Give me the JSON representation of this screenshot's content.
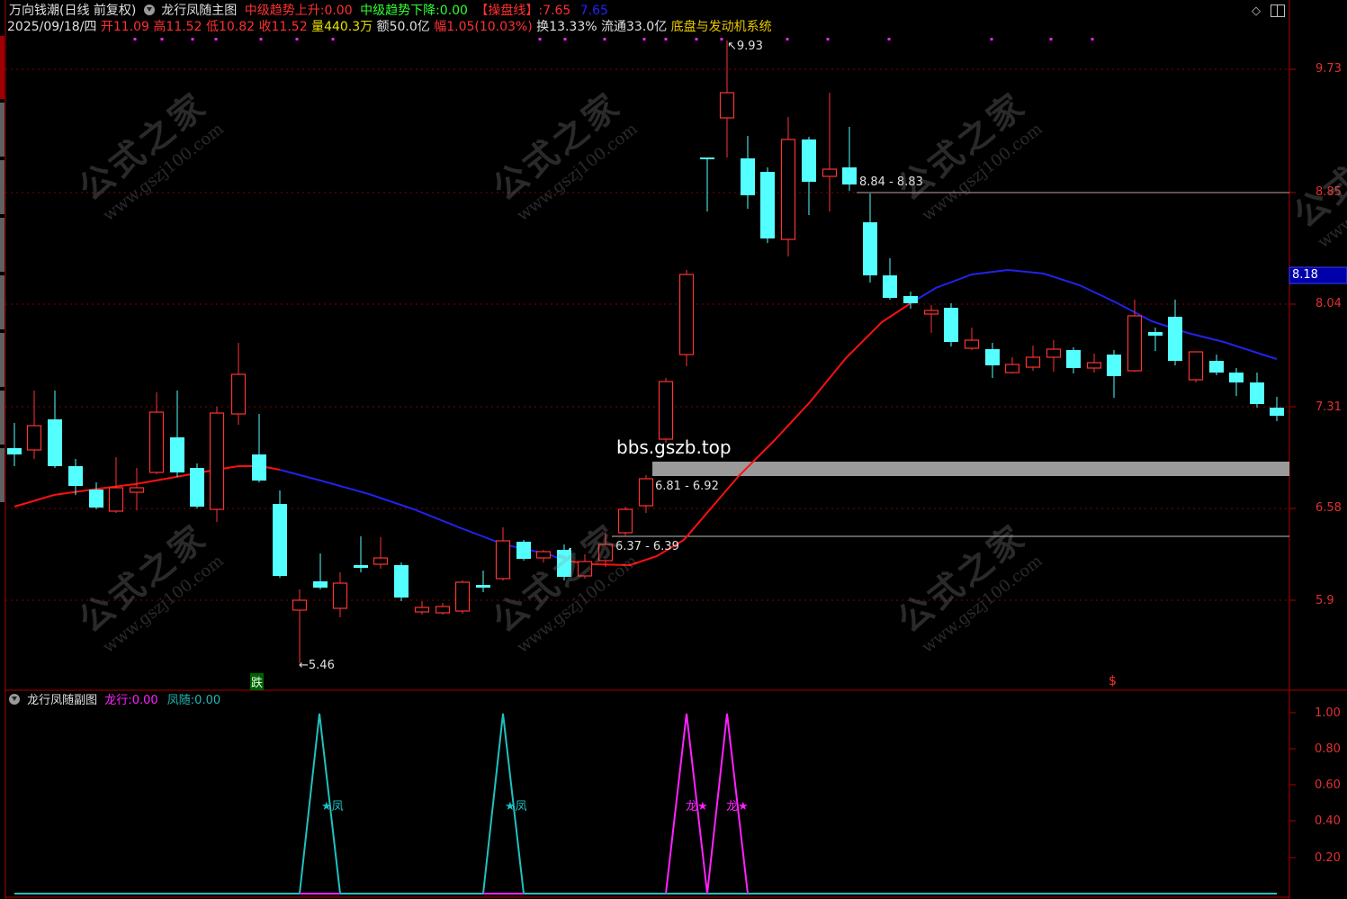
{
  "header": {
    "app_title": "万向钱潮(日线 前复权)",
    "indicator_name": "龙行凤随主图",
    "up_label": "中级趋势上升:",
    "up_value": "0.00",
    "down_label": "中级趋势下降:",
    "down_value": "0.00",
    "pan_label": "【操盘线】:",
    "pan_value_red": "7.65",
    "pan_value_blue": "7.65"
  },
  "quote": {
    "date": "2025/09/18/四",
    "open_label": "开",
    "open": "11.09",
    "high_label": "高",
    "high": "11.52",
    "low_label": "低",
    "low": "10.82",
    "close_label": "收",
    "close": "11.52",
    "vol_label": "量",
    "vol": "440.3万",
    "amt_label": "额",
    "amt": "50.0亿",
    "chg_label": "幅",
    "chg": "1.05(10.03%)",
    "turn_label": "换",
    "turn": "13.33%",
    "float_label": "流通",
    "float": "33.0亿",
    "system_name": "底盘与发动机系统"
  },
  "price_axis": {
    "ticks": [
      "9.73",
      "8.85",
      "8.04",
      "7.31",
      "6.58",
      "5.9"
    ],
    "current_price": "8.18"
  },
  "annotations": {
    "high_mark": "9.93",
    "low_mark": "5.46",
    "level_top": "8.84 - 8.83",
    "level_mid": "6.81 - 6.92",
    "level_low": "6.37 - 6.39",
    "site_text": "bbs.gszb.top",
    "signal_drop": "跌",
    "signal_s": "$"
  },
  "watermark": {
    "text": "公式之家",
    "url": "www.gszj100.com"
  },
  "sub_panel": {
    "title": "龙行凤随副图",
    "long_label": "龙行:",
    "long_value": "0.00",
    "feng_label": "凤随:",
    "feng_value": "0.00",
    "axis_ticks": [
      "1.00",
      "0.80",
      "0.60",
      "0.40",
      "0.20"
    ],
    "feng_mark": "★凤",
    "long_mark": "龙★"
  },
  "colors": {
    "up": "#ff3232",
    "down": "#54ffff",
    "ma_up": "#ff1010",
    "ma_down": "#2222ee",
    "border": "#b00000",
    "magenta": "#ff22ff"
  }
}
